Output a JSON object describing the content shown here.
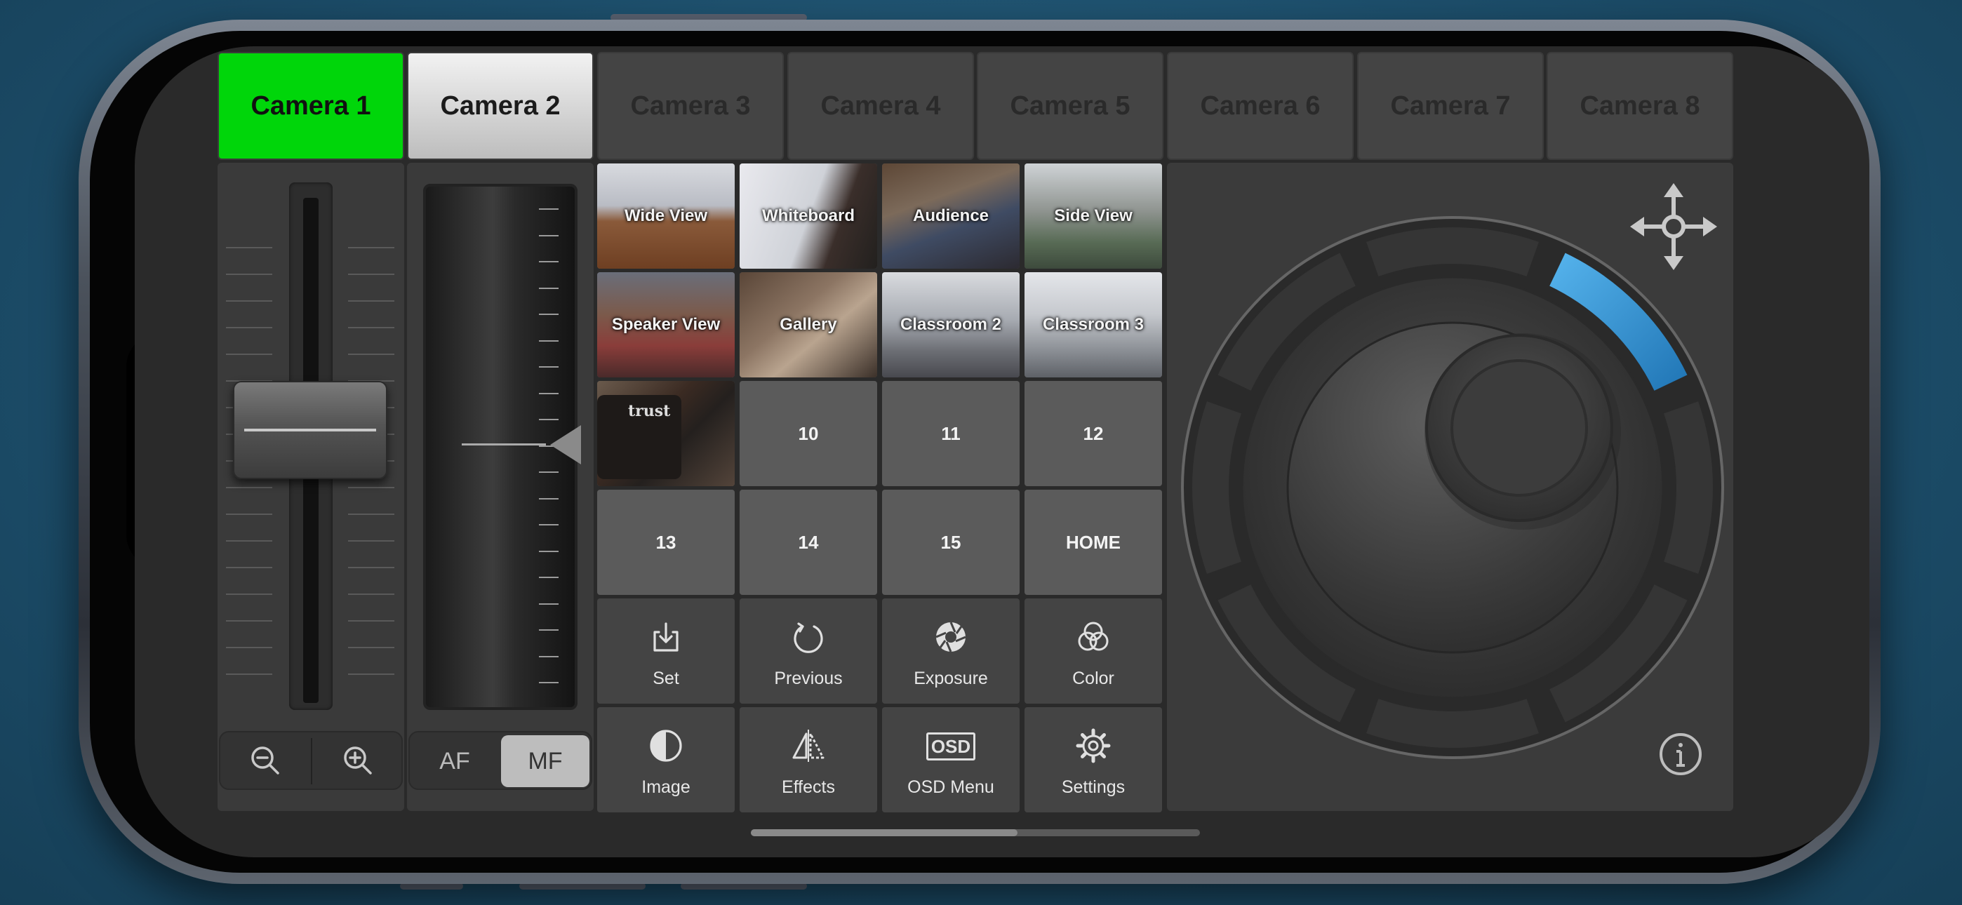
{
  "cameras": [
    {
      "label": "Camera 1",
      "state": "live"
    },
    {
      "label": "Camera 2",
      "state": "preview"
    },
    {
      "label": "Camera 3",
      "state": "idle"
    },
    {
      "label": "Camera 4",
      "state": "idle"
    },
    {
      "label": "Camera 5",
      "state": "idle"
    },
    {
      "label": "Camera 6",
      "state": "idle"
    },
    {
      "label": "Camera 7",
      "state": "idle"
    },
    {
      "label": "Camera 8",
      "state": "idle"
    }
  ],
  "colors": {
    "live": "#00d60a",
    "preview": "#d9d9d9",
    "joystick_accent": "#3aa0e0"
  },
  "zoom": {
    "level": 0.55,
    "zoom_out_icon": "zoom-out-icon",
    "zoom_in_icon": "zoom-in-icon"
  },
  "focus": {
    "af_label": "AF",
    "mf_label": "MF",
    "mode": "MF",
    "level": 0.5
  },
  "presets": [
    {
      "label": "Wide View"
    },
    {
      "label": "Whiteboard"
    },
    {
      "label": "Audience"
    },
    {
      "label": "Side View"
    },
    {
      "label": "Speaker View"
    },
    {
      "label": "Gallery"
    },
    {
      "label": "Classroom 2"
    },
    {
      "label": "Classroom 3"
    },
    {
      "label": ""
    },
    {
      "label": "10"
    },
    {
      "label": "11"
    },
    {
      "label": "12"
    },
    {
      "label": "13"
    },
    {
      "label": "14"
    },
    {
      "label": "15"
    },
    {
      "label": "HOME"
    }
  ],
  "mug_text": "trust",
  "actions": [
    {
      "label": "Set",
      "icon": "download-icon"
    },
    {
      "label": "Previous",
      "icon": "rotate-icon"
    },
    {
      "label": "Exposure",
      "icon": "aperture-icon"
    },
    {
      "label": "Color",
      "icon": "color-circles-icon"
    },
    {
      "label": "Image",
      "icon": "half-circle-icon"
    },
    {
      "label": "Effects",
      "icon": "mirror-triangle-icon"
    },
    {
      "label": "OSD Menu",
      "icon": "osd-icon"
    },
    {
      "label": "Settings",
      "icon": "gear-icon"
    }
  ],
  "osd_icon_text": "OSD",
  "joystick": {
    "move_icon": "move-arrows-icon",
    "info_icon": "info-icon"
  }
}
